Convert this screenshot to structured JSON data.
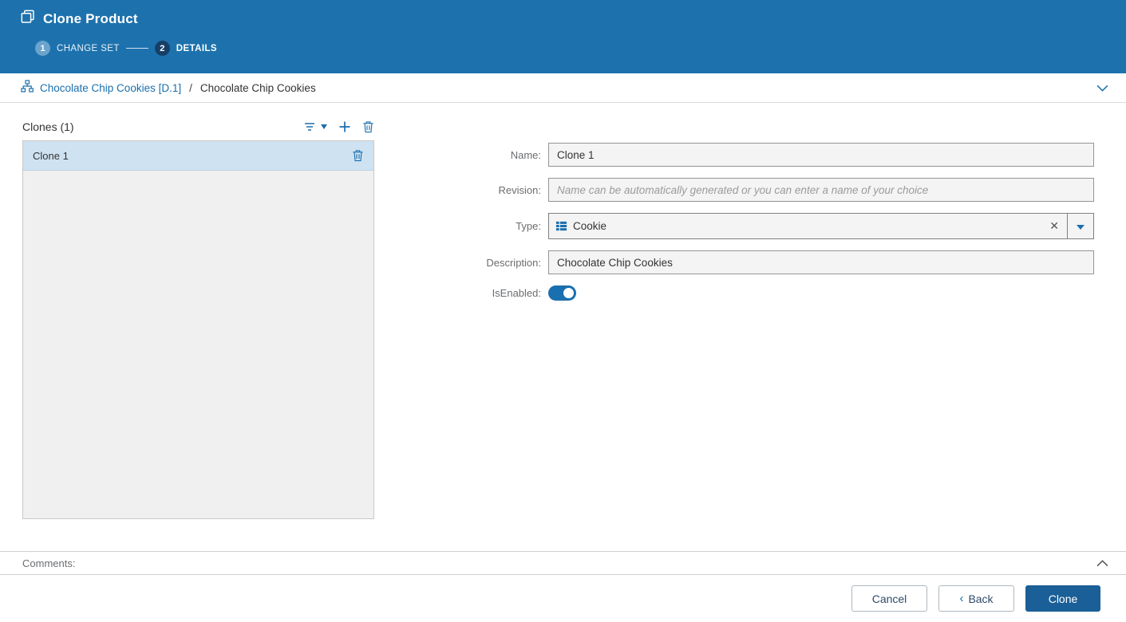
{
  "header": {
    "title": "Clone Product",
    "steps": [
      {
        "number": "1",
        "label": "CHANGE SET"
      },
      {
        "number": "2",
        "label": "DETAILS"
      }
    ]
  },
  "breadcrumb": {
    "link": "Chocolate Chip Cookies [D.1]",
    "separator": "/",
    "current": "Chocolate Chip Cookies"
  },
  "clones_panel": {
    "title": "Clones (1)",
    "items": [
      {
        "name": "Clone 1"
      }
    ]
  },
  "form": {
    "name_label": "Name:",
    "name_value": "Clone 1",
    "revision_label": "Revision:",
    "revision_placeholder": "Name can be automatically generated or you can enter a name of your choice",
    "type_label": "Type:",
    "type_value": "Cookie",
    "description_label": "Description:",
    "description_value": "Chocolate Chip Cookies",
    "isenabled_label": "IsEnabled:",
    "isenabled_state": "on"
  },
  "comments": {
    "label": "Comments:"
  },
  "footer": {
    "cancel_label": "Cancel",
    "back_label": "Back",
    "back_chevron": "‹",
    "clone_label": "Clone"
  },
  "colors": {
    "header_blue": "#1d72ad",
    "accent_blue": "#1a6fae",
    "primary_button_blue": "#1a5f97",
    "selected_item_blue": "#cfe2f1",
    "step_active_circle": "#173f66"
  }
}
